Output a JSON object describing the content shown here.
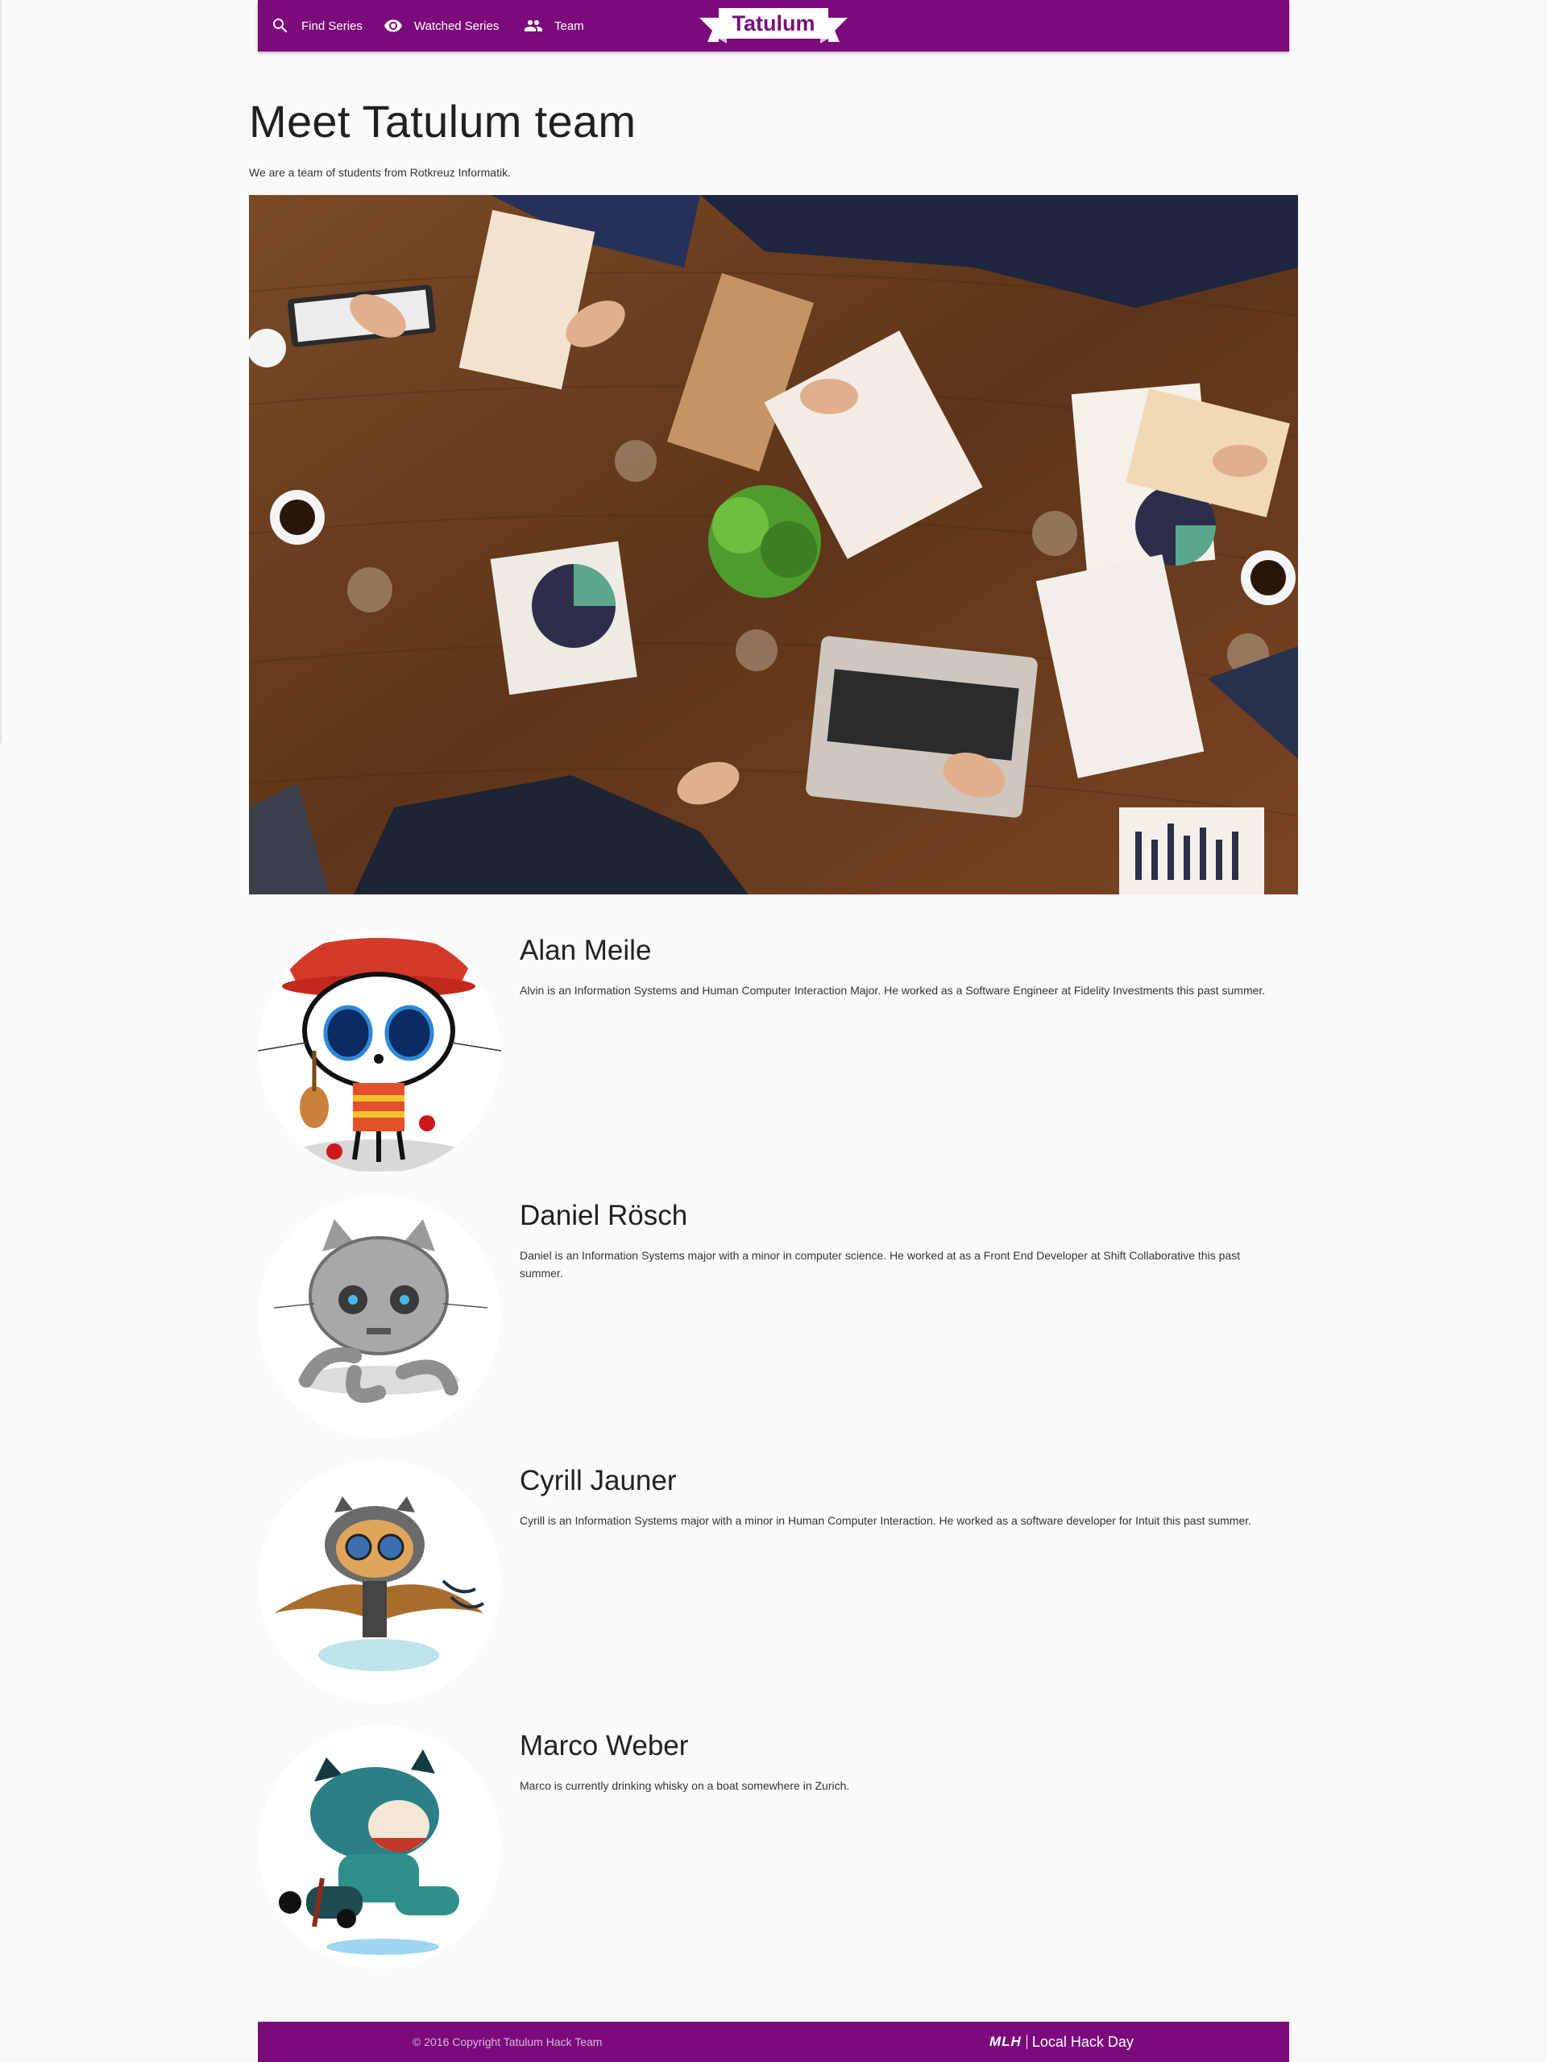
{
  "nav": {
    "items": [
      {
        "label": "Find Series",
        "icon": "search-icon"
      },
      {
        "label": "Watched Series",
        "icon": "eye-icon"
      },
      {
        "label": "Team",
        "icon": "people-icon"
      }
    ],
    "brand": "Tatulum",
    "background_color": "#7b0b7b"
  },
  "header": {
    "title": "Meet Tatulum team",
    "subtitle": "We are a team of students from Rotkreuz Informatik."
  },
  "hero": {
    "image_subject": "people working at a wooden table with laptops, charts and coffee"
  },
  "team": [
    {
      "name": "Alan Meile",
      "bio": "Alvin is an Information Systems and Human Computer Interaction Major. He worked as a Software Engineer at Fidelity Investments this past summer.",
      "avatar": "skeleton-octocat-avatar"
    },
    {
      "name": "Daniel Rösch",
      "bio": "Daniel is an Information Systems major with a minor in computer science. He worked at as a Front End Developer at Shift Collaborative this past summer.",
      "avatar": "robot-octocat-avatar"
    },
    {
      "name": "Cyrill Jauner",
      "bio": "Cyrill is an Information Systems major with a minor in Human Computer Interaction. He worked as a software developer for Intuit this past summer.",
      "avatar": "aviator-octocat-avatar"
    },
    {
      "name": "Marco Weber",
      "bio": "Marco is currently drinking whisky on a boat somewhere in Zurich.",
      "avatar": "samurai-octocat-avatar"
    }
  ],
  "footer": {
    "copyright": "© 2016 Copyright Tatulum Hack Team",
    "mlh_logo": "MLH",
    "mlh_text": "Local Hack Day"
  }
}
